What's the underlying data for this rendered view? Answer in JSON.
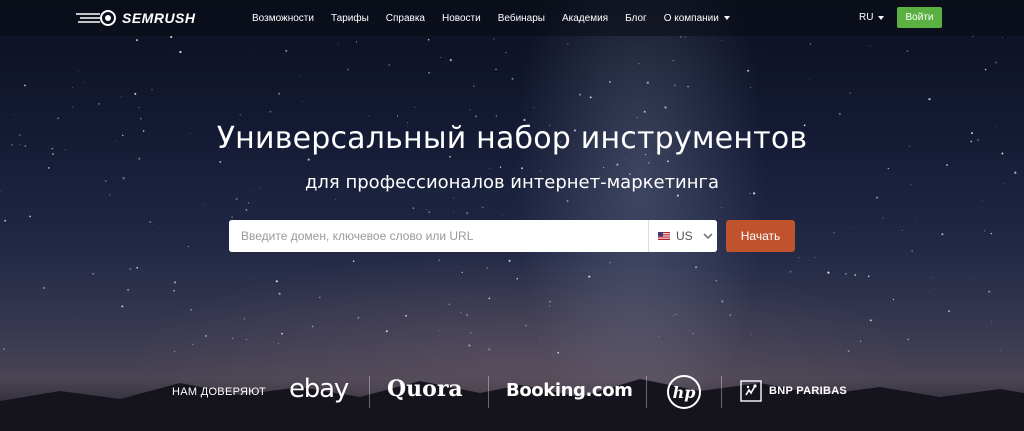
{
  "brand": {
    "logo_text": "SEMRUSH"
  },
  "nav": {
    "items": [
      {
        "label": "Возможности"
      },
      {
        "label": "Тарифы"
      },
      {
        "label": "Справка"
      },
      {
        "label": "Новости"
      },
      {
        "label": "Вебинары"
      },
      {
        "label": "Академия"
      },
      {
        "label": "Блог"
      },
      {
        "label": "О компании"
      }
    ],
    "language": "RU",
    "login_label": "Войти"
  },
  "hero": {
    "headline": "Универсальный набор инструментов",
    "subheadline": "для профессионалов интернет-маркетинга"
  },
  "search": {
    "placeholder": "Введите домен, ключевое слово или URL",
    "value": "",
    "country": "US",
    "flag_icon": "us-flag-icon",
    "submit_label": "Начать"
  },
  "trust": {
    "label": "НАМ ДОВЕРЯЮТ",
    "brands": [
      "ebay",
      "Quora",
      "Booking.com",
      "hp",
      "BNP PARIBAS"
    ]
  },
  "colors": {
    "login_button": "#5bb042",
    "start_button": "#c0522e",
    "topbar": "#0a0c14"
  }
}
